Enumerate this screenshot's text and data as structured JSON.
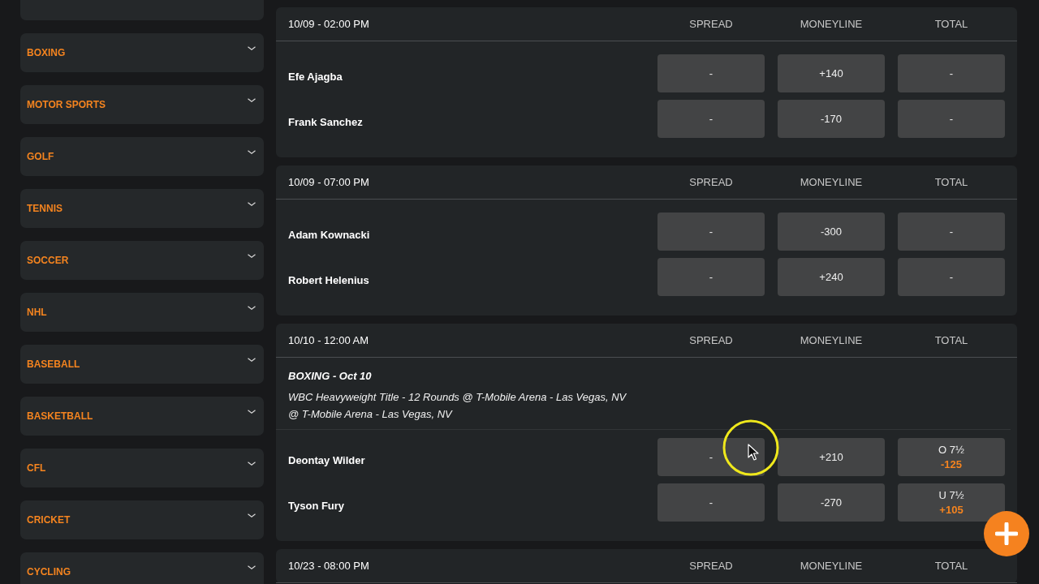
{
  "sidebar": {
    "items": [
      {
        "label": "BOXING",
        "expanded": false
      },
      {
        "label": "MOTOR SPORTS",
        "expanded": false
      },
      {
        "label": "GOLF",
        "expanded": false
      },
      {
        "label": "TENNIS",
        "expanded": false
      },
      {
        "label": "SOCCER",
        "expanded": false
      },
      {
        "label": "NHL",
        "expanded": false
      },
      {
        "label": "BASEBALL",
        "expanded": false
      },
      {
        "label": "BASKETBALL",
        "expanded": false
      },
      {
        "label": "CFL",
        "expanded": false
      },
      {
        "label": "CRICKET",
        "expanded": false
      },
      {
        "label": "CYCLING",
        "expanded": false
      }
    ]
  },
  "events": [
    {
      "datetime": "10/09 - 02:00 PM",
      "columns": [
        "SPREAD",
        "MONEYLINE",
        "TOTAL"
      ],
      "competitors": [
        {
          "name": "Efe Ajagba",
          "odds": [
            {
              "line": "-"
            },
            {
              "line": "+140"
            },
            {
              "line": "-"
            }
          ]
        },
        {
          "name": "Frank Sanchez",
          "odds": [
            {
              "line": "-"
            },
            {
              "line": "-170"
            },
            {
              "line": "-"
            }
          ]
        }
      ]
    },
    {
      "datetime": "10/09 - 07:00 PM",
      "columns": [
        "SPREAD",
        "MONEYLINE",
        "TOTAL"
      ],
      "competitors": [
        {
          "name": "Adam Kownacki",
          "odds": [
            {
              "line": "-"
            },
            {
              "line": "-300"
            },
            {
              "line": "-"
            }
          ]
        },
        {
          "name": "Robert Helenius",
          "odds": [
            {
              "line": "-"
            },
            {
              "line": "+240"
            },
            {
              "line": "-"
            }
          ]
        }
      ]
    },
    {
      "datetime": "10/10 - 12:00 AM",
      "columns": [
        "SPREAD",
        "MONEYLINE",
        "TOTAL"
      ],
      "info": {
        "title": "BOXING - Oct 10",
        "lines": [
          "WBC Heavyweight Title - 12 Rounds @ T-Mobile Arena - Las Vegas, NV",
          "@ T-Mobile Arena - Las Vegas, NV"
        ]
      },
      "competitors": [
        {
          "name": "Deontay Wilder",
          "odds": [
            {
              "line": "-"
            },
            {
              "line": "+210"
            },
            {
              "line": "O 7½",
              "price": "-125"
            }
          ]
        },
        {
          "name": "Tyson Fury",
          "odds": [
            {
              "line": "-"
            },
            {
              "line": "-270"
            },
            {
              "line": "U 7½",
              "price": "+105"
            }
          ]
        }
      ]
    },
    {
      "datetime": "10/23 - 08:00 PM",
      "columns": [
        "SPREAD",
        "MONEYLINE",
        "TOTAL"
      ]
    }
  ]
}
